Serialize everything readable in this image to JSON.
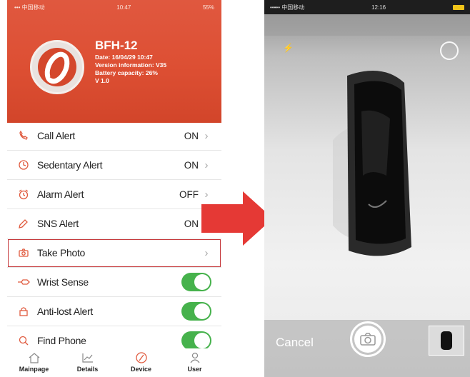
{
  "left_phone": {
    "status_bar": {
      "carrier": "••• 中国移动",
      "time": "10:47",
      "battery": "55%"
    },
    "device": {
      "name": "BFH-12",
      "info": [
        "Date: 16/04/29 10:47",
        "Version information: V35",
        "Battery capacity: 26%",
        "V 1.0"
      ]
    },
    "menu": [
      {
        "label": "Call Alert",
        "value": "ON",
        "icon": "phone-icon"
      },
      {
        "label": "Sedentary Alert",
        "value": "ON",
        "icon": "clock-icon"
      },
      {
        "label": "Alarm Alert",
        "value": "OFF",
        "icon": "alarm-icon"
      },
      {
        "label": "SNS Alert",
        "value": "ON",
        "icon": "message-icon"
      },
      {
        "label": "Take Photo",
        "value": "",
        "icon": "camera-icon"
      },
      {
        "label": "Wrist Sense",
        "value": "",
        "icon": "wrist-icon",
        "toggle": true
      },
      {
        "label": "Anti-lost Alert",
        "value": "",
        "icon": "lock-icon",
        "toggle": true
      },
      {
        "label": "Find Phone",
        "value": "",
        "icon": "search-icon",
        "toggle": true
      }
    ],
    "tabs": [
      {
        "label": "Mainpage",
        "icon": "home-icon"
      },
      {
        "label": "Details",
        "icon": "chart-icon"
      },
      {
        "label": "Device",
        "icon": "watch-icon"
      },
      {
        "label": "User",
        "icon": "user-icon"
      }
    ],
    "colors": {
      "header": "#dd4f33",
      "toggle_on": "#46b24c",
      "icon": "#e05a3e",
      "highlight": "#c5393c"
    }
  },
  "right_phone": {
    "status_bar": {
      "carrier": "••••• 中国移动",
      "time": "12:16"
    },
    "cancel_label": "Cancel",
    "icons": [
      "flash-icon",
      "switch-camera-icon",
      "shutter-icon",
      "thumbnail"
    ]
  },
  "arrow_color": "#e53935"
}
